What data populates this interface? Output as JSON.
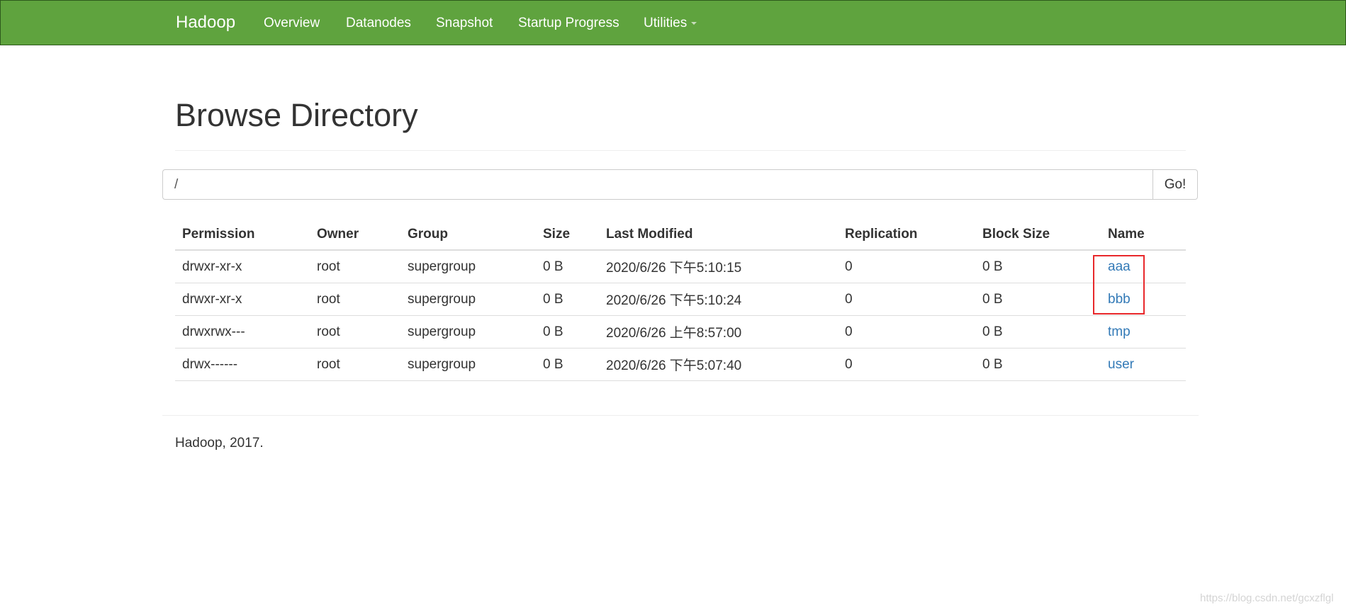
{
  "navbar": {
    "brand": "Hadoop",
    "items": [
      {
        "label": "Overview"
      },
      {
        "label": "Datanodes"
      },
      {
        "label": "Snapshot"
      },
      {
        "label": "Startup Progress"
      },
      {
        "label": "Utilities",
        "has_dropdown": true
      }
    ],
    "background_color": "#5fa33e"
  },
  "page": {
    "title": "Browse Directory"
  },
  "path_bar": {
    "value": "/",
    "go_label": "Go!"
  },
  "table": {
    "headers": [
      "Permission",
      "Owner",
      "Group",
      "Size",
      "Last Modified",
      "Replication",
      "Block Size",
      "Name"
    ],
    "rows": [
      {
        "permission": "drwxr-xr-x",
        "owner": "root",
        "group": "supergroup",
        "size": "0 B",
        "last_modified": "2020/6/26 下午5:10:15",
        "replication": "0",
        "block_size": "0 B",
        "name": "aaa"
      },
      {
        "permission": "drwxr-xr-x",
        "owner": "root",
        "group": "supergroup",
        "size": "0 B",
        "last_modified": "2020/6/26 下午5:10:24",
        "replication": "0",
        "block_size": "0 B",
        "name": "bbb"
      },
      {
        "permission": "drwxrwx---",
        "owner": "root",
        "group": "supergroup",
        "size": "0 B",
        "last_modified": "2020/6/26 上午8:57:00",
        "replication": "0",
        "block_size": "0 B",
        "name": "tmp"
      },
      {
        "permission": "drwx------",
        "owner": "root",
        "group": "supergroup",
        "size": "0 B",
        "last_modified": "2020/6/26 下午5:07:40",
        "replication": "0",
        "block_size": "0 B",
        "name": "user"
      }
    ],
    "link_color": "#337ab7",
    "highlight_color": "#e8282b"
  },
  "footer": {
    "text": "Hadoop, 2017."
  },
  "watermark": "https://blog.csdn.net/gcxzflgl"
}
